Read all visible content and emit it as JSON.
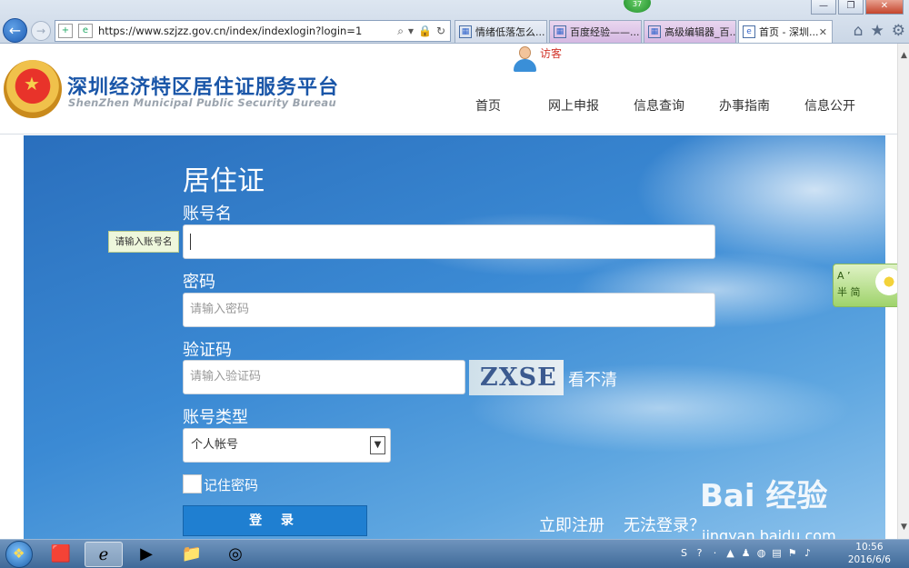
{
  "browser": {
    "url": "https://www.szjzz.gov.cn/index/indexlogin?login=1",
    "badge": "37",
    "tabs": [
      {
        "label": "情绪低落怎么..."
      },
      {
        "label": "百度经验——..."
      },
      {
        "label": "高级编辑器_百..."
      },
      {
        "label": "首页 - 深圳...",
        "active": true
      }
    ]
  },
  "header": {
    "site_title": "深圳经济特区居住证服务平台",
    "site_subtitle": "ShenZhen Municipal Public Security Bureau",
    "visitor": "访客",
    "nav": [
      "首页",
      "网上申报",
      "信息查询",
      "办事指南",
      "信息公开"
    ]
  },
  "form": {
    "title": "居住证",
    "account_label": "账号名",
    "account_tooltip": "请输入账号名",
    "password_label": "密码",
    "password_placeholder": "请输入密码",
    "captcha_label": "验证码",
    "captcha_placeholder": "请输入验证码",
    "captcha_text": "ZXSE",
    "captcha_refresh": "看不清",
    "account_type_label": "账号类型",
    "account_type_value": "个人帐号",
    "remember_label": "记住密码",
    "login_button": "登 录",
    "register_link": "立即注册",
    "cannot_login_link": "无法登录？"
  },
  "translate_widget": {
    "line1": "A  ʼ",
    "line2": "半 简"
  },
  "watermark": {
    "text": "Bai 经验",
    "url": "jingyan.baidu.com"
  },
  "taskbar": {
    "time": "10:56",
    "date": "2016/6/6"
  },
  "colors": {
    "brand_blue": "#1a56a8",
    "login_button": "#1f7fd1",
    "visitor_red": "#d2342a"
  }
}
